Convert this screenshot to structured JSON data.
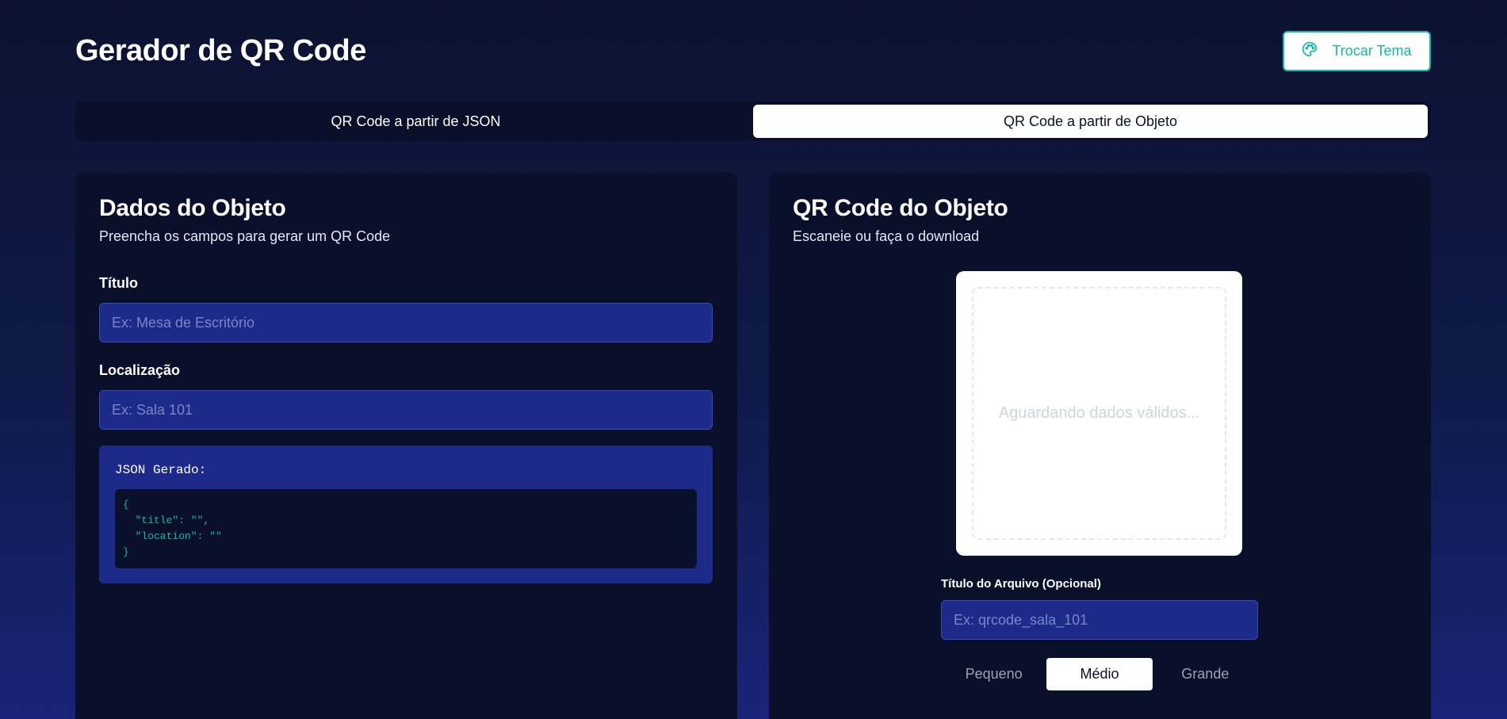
{
  "header": {
    "title": "Gerador de QR Code",
    "theme_button_label": "Trocar Tema",
    "theme_icon": "palette-icon"
  },
  "tabs": [
    {
      "label": "QR Code a partir de JSON",
      "active": false
    },
    {
      "label": "QR Code a partir de Objeto",
      "active": true
    }
  ],
  "form": {
    "title": "Dados do Objeto",
    "subtitle": "Preencha os campos para gerar um QR Code",
    "title_field": {
      "label": "Título",
      "placeholder": "Ex: Mesa de Escritório",
      "value": ""
    },
    "location_field": {
      "label": "Localização",
      "placeholder": "Ex: Sala 101",
      "value": ""
    },
    "json_label": "JSON Gerado:",
    "json_output": "{\n  \"title\": \"\",\n  \"location\": \"\"\n}"
  },
  "qr": {
    "title": "QR Code do Objeto",
    "subtitle": "Escaneie ou faça o download",
    "placeholder_text": "Aguardando dados válidos...",
    "file_field": {
      "label": "Título do Arquivo (Opcional)",
      "placeholder": "Ex: qrcode_sala_101",
      "value": ""
    },
    "sizes": [
      {
        "label": "Pequeno",
        "active": false
      },
      {
        "label": "Médio",
        "active": true
      },
      {
        "label": "Grande",
        "active": false
      }
    ]
  },
  "colors": {
    "accent": "#14b8a6",
    "card_bg": "#0a0f2a",
    "input_bg": "#1e2a8a"
  }
}
